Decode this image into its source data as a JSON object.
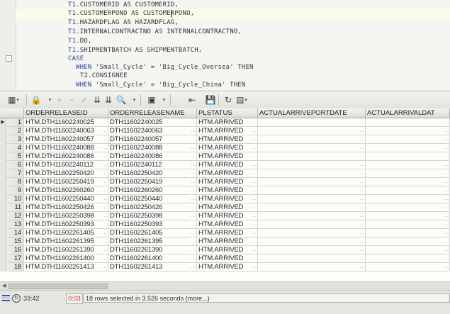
{
  "editor": {
    "lines": [
      {
        "kw": "T1.",
        "id": "CUSTOMERID AS CUSTOMERID,"
      },
      {
        "kw": "T1.",
        "id": "CUSTOMERPONO AS CUSTOMERPONO,"
      },
      {
        "kw": "T1.",
        "id": "HAZARDFLAG AS HAZARDFLAG,"
      },
      {
        "kw": "T1.",
        "id": "INTERNALCONTRACTNO AS INTERNALCONTRACTNO,"
      },
      {
        "kw": "T1.",
        "id": "DO,"
      },
      {
        "kw": "T1.",
        "id": "SHIPMENTBATCH AS SHIPMENTBATCH,"
      },
      {
        "kw": "CASE",
        "id": ""
      },
      {
        "kw": "WHEN ",
        "id": "'Small_Cycle' = 'Big_Cycle_Oversea' THEN"
      },
      {
        "kw": "",
        "id": "T2.CONSIGNEE"
      },
      {
        "kw": "WHEN ",
        "id": "'Small_Cycle' = 'Big_Cycle_China' THEN"
      }
    ]
  },
  "toolbar": {
    "icons": [
      "grid-icon",
      "lock-icon",
      "add-icon",
      "remove-icon",
      "check-icon",
      "filter-down-icon",
      "filter-down-icon",
      "find-icon",
      "lock-open-icon",
      "chart-icon",
      "export-icon",
      "save-icon",
      "refresh-icon",
      "table-icon"
    ]
  },
  "grid": {
    "columns": [
      "ORDERRELEASEID",
      "ORDERRELEASENAME",
      "PLSTATUS",
      "ACTUALARRIVEPORTDATE",
      "ACTUALARRIVALDAT"
    ],
    "rows": [
      {
        "n": "1",
        "id": "HTM.DTH11602240025",
        "name": "DTH11602240025",
        "status": "HTM.ARRIVED"
      },
      {
        "n": "2",
        "id": "HTM.DTH11602240063",
        "name": "DTH11602240063",
        "status": "HTM.ARRIVED"
      },
      {
        "n": "3",
        "id": "HTM.DTH11602240057",
        "name": "DTH11602240057",
        "status": "HTM.ARRIVED"
      },
      {
        "n": "4",
        "id": "HTM.DTH11602240088",
        "name": "DTH11602240088",
        "status": "HTM.ARRIVED"
      },
      {
        "n": "5",
        "id": "HTM.DTH11602240086",
        "name": "DTH11602240086",
        "status": "HTM.ARRIVED"
      },
      {
        "n": "6",
        "id": "HTM.DTH11602240112",
        "name": "DTH11602240112",
        "status": "HTM.ARRIVED"
      },
      {
        "n": "7",
        "id": "HTM.DTH11602250420",
        "name": "DTH11602250420",
        "status": "HTM.ARRIVED"
      },
      {
        "n": "8",
        "id": "HTM.DTH11602250419",
        "name": "DTH11602250419",
        "status": "HTM.ARRIVED"
      },
      {
        "n": "9",
        "id": "HTM.DTH11602260260",
        "name": "DTH11602260260",
        "status": "HTM.ARRIVED"
      },
      {
        "n": "10",
        "id": "HTM.DTH11602250440",
        "name": "DTH11602250440",
        "status": "HTM.ARRIVED"
      },
      {
        "n": "11",
        "id": "HTM.DTH11602250426",
        "name": "DTH11602250426",
        "status": "HTM.ARRIVED"
      },
      {
        "n": "12",
        "id": "HTM.DTH11602250398",
        "name": "DTH11602250398",
        "status": "HTM.ARRIVED"
      },
      {
        "n": "13",
        "id": "HTM.DTH11602250393",
        "name": "DTH11602250393",
        "status": "HTM.ARRIVED"
      },
      {
        "n": "14",
        "id": "HTM.DTH11602261405",
        "name": "DTH11602261405",
        "status": "HTM.ARRIVED"
      },
      {
        "n": "15",
        "id": "HTM.DTH11602261395",
        "name": "DTH11602261395",
        "status": "HTM.ARRIVED"
      },
      {
        "n": "16",
        "id": "HTM.DTH11602261390",
        "name": "DTH11602261390",
        "status": "HTM.ARRIVED"
      },
      {
        "n": "17",
        "id": "HTM.DTH11602261400",
        "name": "DTH11602261400",
        "status": "HTM.ARRIVED"
      },
      {
        "n": "18",
        "id": "HTM.DTH11602261413",
        "name": "DTH11602261413",
        "status": "HTM.ARRIVED"
      }
    ]
  },
  "status": {
    "position": "33:42",
    "time": "0:03",
    "message": "18 rows selected in 3.526 seconds (more...)"
  }
}
